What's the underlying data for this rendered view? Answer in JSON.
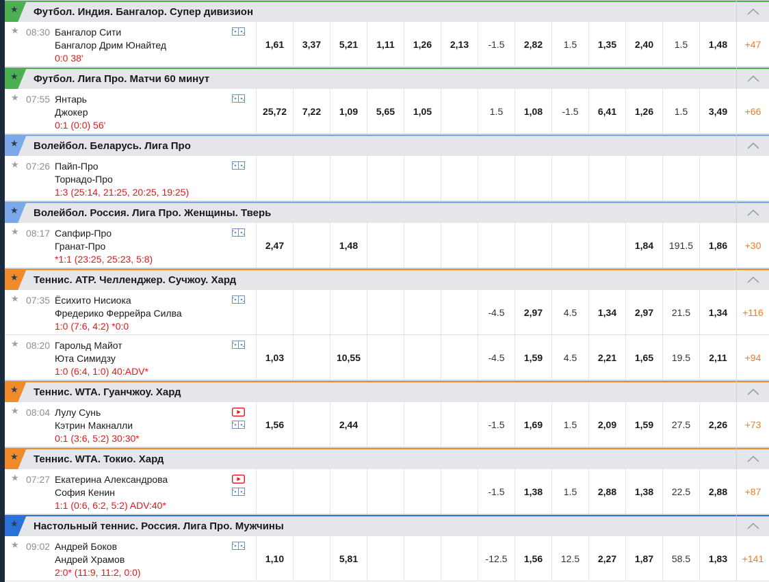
{
  "colors": {
    "football": "#4caf50",
    "volleyball": "#7aa8e8",
    "tennis": "#f08a2a",
    "table_tennis": "#2a72d9",
    "score": "#e8161b",
    "more_bets": "#f07c1e"
  },
  "icons": {
    "favorite": "star-icon",
    "stats": "statistics-icon",
    "video": "video-play-icon",
    "collapse": "chevron-up-icon"
  },
  "sections": [
    {
      "title": "Футбол. Индия. Бангалор. Супер дивизион",
      "sport": "football",
      "matches": [
        {
          "time": "08:30",
          "team1": "Бангалор Сити",
          "team2": "Бангалор Дрим Юнайтед",
          "score": "0:0 38'",
          "video": false,
          "odds": [
            "1,61",
            "3,37",
            "5,21",
            "1,11",
            "1,26",
            "2,13",
            "-1.5",
            "2,82",
            "1.5",
            "1,35",
            "2,40",
            "1.5",
            "1,48"
          ],
          "more": "+47"
        }
      ]
    },
    {
      "title": "Футбол. Лига Про. Матчи 60 минут",
      "sport": "football",
      "matches": [
        {
          "time": "07:55",
          "team1": "Янтарь",
          "team2": "Джокер",
          "score": "0:1 (0:0) 56'",
          "video": false,
          "odds": [
            "25,72",
            "7,22",
            "1,09",
            "5,65",
            "1,05",
            "",
            "1.5",
            "1,08",
            "-1.5",
            "6,41",
            "1,26",
            "1.5",
            "3,49"
          ],
          "more": "+66"
        }
      ]
    },
    {
      "title": "Волейбол. Беларусь. Лига Про",
      "sport": "volleyball",
      "matches": [
        {
          "time": "07:26",
          "team1": "Пайп-Про",
          "team2": "Торнадо-Про",
          "score": "1:3 (25:14, 21:25, 20:25, 19:25)",
          "video": false,
          "odds": [
            "",
            "",
            "",
            "",
            "",
            "",
            "",
            "",
            "",
            "",
            "",
            "",
            ""
          ],
          "more": ""
        }
      ]
    },
    {
      "title": "Волейбол. Россия. Лига Про. Женщины. Тверь",
      "sport": "volleyball",
      "matches": [
        {
          "time": "08:17",
          "team1": "Сапфир-Про",
          "team2": "Гранат-Про",
          "score": "*1:1 (23:25, 25:23, 5:8)",
          "video": false,
          "odds": [
            "2,47",
            "",
            "1,48",
            "",
            "",
            "",
            "",
            "",
            "",
            "",
            "1,84",
            "191.5",
            "1,86"
          ],
          "more": "+30"
        }
      ]
    },
    {
      "title": "Теннис. ATP. Челленджер. Сучжоу. Хард",
      "sport": "tennis",
      "matches": [
        {
          "time": "07:35",
          "team1": "Ёсихито Нисиока",
          "team2": "Фредерико Феррейра Силва",
          "score": "1:0 (7:6, 4:2) *0:0",
          "video": false,
          "odds": [
            "",
            "",
            "",
            "",
            "",
            "",
            "-4.5",
            "2,97",
            "4.5",
            "1,34",
            "2,97",
            "21.5",
            "1,34"
          ],
          "more": "+116"
        },
        {
          "time": "08:20",
          "team1": "Гарольд Майот",
          "team2": "Юта Симидзу",
          "score": "1:0 (6:4, 1:0) 40:ADV*",
          "video": false,
          "odds": [
            "1,03",
            "",
            "10,55",
            "",
            "",
            "",
            "-4.5",
            "1,59",
            "4.5",
            "2,21",
            "1,65",
            "19.5",
            "2,11"
          ],
          "more": "+94"
        }
      ]
    },
    {
      "title": "Теннис. WTA. Гуанчжоу. Хард",
      "sport": "tennis",
      "matches": [
        {
          "time": "08:04",
          "team1": "Лулу Сунь",
          "team2": "Кэтрин Макналли",
          "score": "0:1 (3:6, 5:2) 30:30*",
          "video": true,
          "odds": [
            "1,56",
            "",
            "2,44",
            "",
            "",
            "",
            "-1.5",
            "1,69",
            "1.5",
            "2,09",
            "1,59",
            "27.5",
            "2,26"
          ],
          "more": "+73"
        }
      ]
    },
    {
      "title": "Теннис. WTA. Токио. Хард",
      "sport": "tennis",
      "matches": [
        {
          "time": "07:27",
          "team1": "Екатерина Александрова",
          "team2": "София Кенин",
          "score": "1:1 (0:6, 6:2, 5:2) ADV:40*",
          "video": true,
          "odds": [
            "",
            "",
            "",
            "",
            "",
            "",
            "-1.5",
            "1,38",
            "1.5",
            "2,88",
            "1,38",
            "22.5",
            "2,88"
          ],
          "more": "+87"
        }
      ]
    },
    {
      "title": "Настольный теннис. Россия. Лига Про. Мужчины",
      "sport": "table_tennis",
      "matches": [
        {
          "time": "09:02",
          "team1": "Андрей Боков",
          "team2": "Андрей Храмов",
          "score": "2:0* (11:9, 11:2, 0:0)",
          "video": false,
          "odds": [
            "1,10",
            "",
            "5,81",
            "",
            "",
            "",
            "-12.5",
            "1,56",
            "12.5",
            "2,27",
            "1,87",
            "58.5",
            "1,83"
          ],
          "more": "+141"
        }
      ]
    }
  ]
}
